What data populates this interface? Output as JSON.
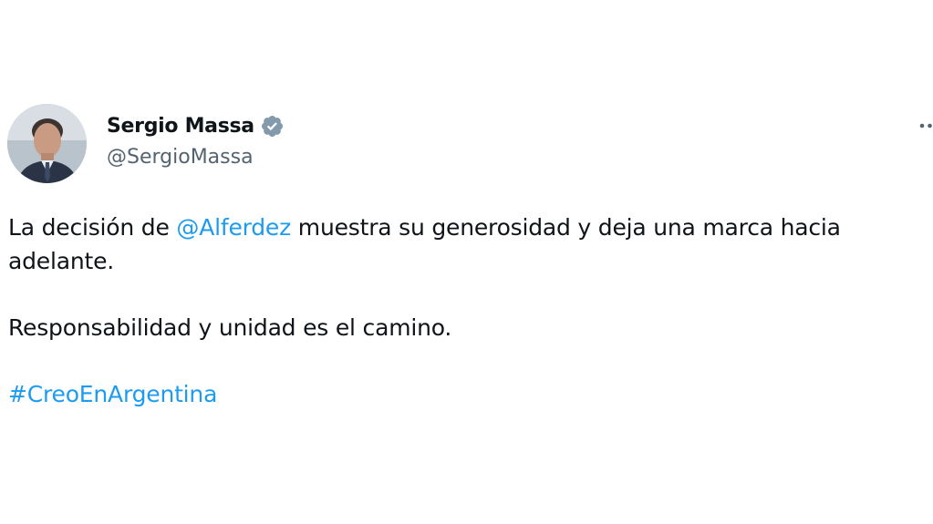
{
  "author": {
    "display_name": "Sergio Massa",
    "handle": "@SergioMassa",
    "verified_icon": "verified-badge-icon",
    "avatar_icon": "profile-photo"
  },
  "menu": {
    "more_icon": "more-options-icon"
  },
  "tweet": {
    "line1_prefix": "La decisión de ",
    "mention": "@Alferdez",
    "line1_suffix": " muestra su generosidad y deja una marca hacia",
    "line2": "adelante.",
    "paragraph2": "Responsabilidad y unidad es el camino.",
    "hashtag": "#CreoEnArgentina"
  },
  "colors": {
    "text": "#0f1419",
    "secondary": "#536471",
    "link": "#1d9bf0",
    "verified": "#829aab"
  }
}
